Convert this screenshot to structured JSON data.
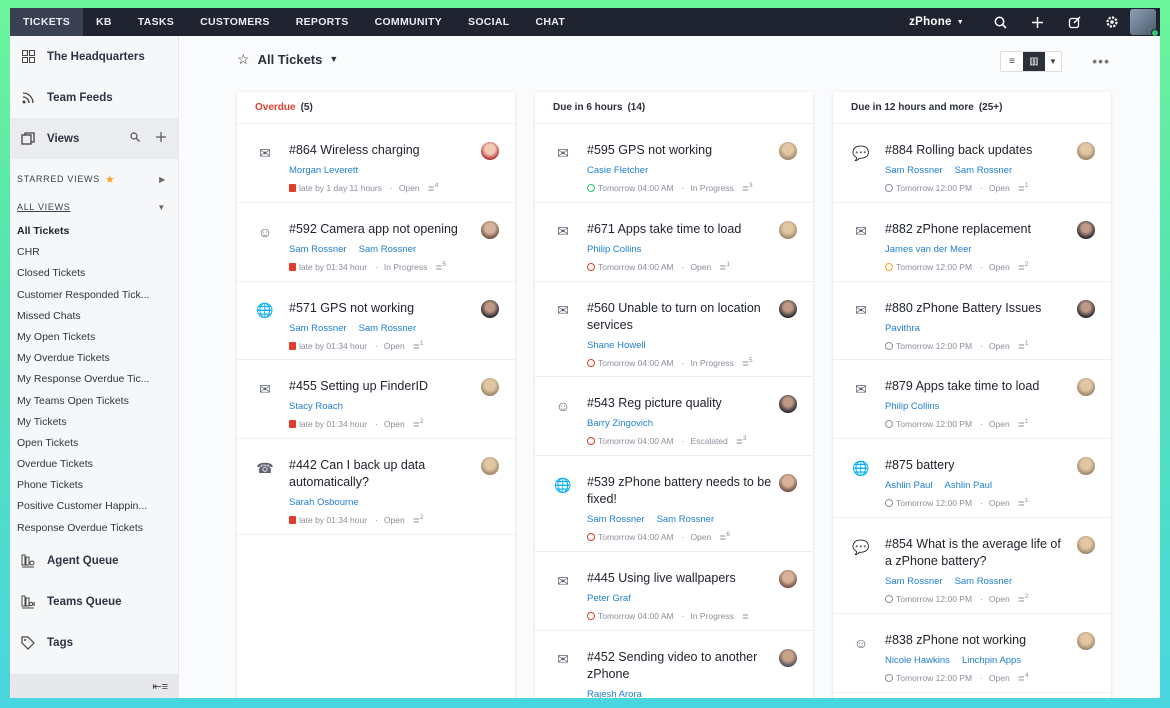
{
  "topnav": {
    "items": [
      {
        "label": "TICKETS",
        "active": true
      },
      {
        "label": "KB"
      },
      {
        "label": "TASKS"
      },
      {
        "label": "CUSTOMERS"
      },
      {
        "label": "REPORTS"
      },
      {
        "label": "COMMUNITY"
      },
      {
        "label": "SOCIAL"
      },
      {
        "label": "CHAT"
      }
    ],
    "brand": "zPhone",
    "icons": [
      "search-icon",
      "plus-icon",
      "compose-icon",
      "gear-icon"
    ]
  },
  "sidebar": {
    "top_items": [
      {
        "label": "The Headquarters",
        "icon": "grid-icon"
      },
      {
        "label": "Team Feeds",
        "icon": "rss-icon"
      }
    ],
    "views_label": "Views",
    "starred_label": "STARRED VIEWS",
    "all_views_label": "ALL VIEWS",
    "views": [
      "All Tickets",
      "CHR",
      "Closed Tickets",
      "Customer Responded Tick...",
      "Missed Chats",
      "My Open Tickets",
      "My Overdue Tickets",
      "My Response Overdue Tic...",
      "My Teams Open Tickets",
      "My Tickets",
      "Open Tickets",
      "Overdue Tickets",
      "Phone Tickets",
      "Positive Customer Happin...",
      "Response Overdue Tickets"
    ],
    "bottom_items": [
      {
        "label": "Agent Queue",
        "icon": "agent-queue-icon"
      },
      {
        "label": "Teams Queue",
        "icon": "teams-queue-icon"
      },
      {
        "label": "Tags",
        "icon": "tags-icon"
      }
    ]
  },
  "header": {
    "title": "All Tickets"
  },
  "colors": {
    "overdue": "#e23c2b",
    "link": "#1f7fd1",
    "nav_bg": "#1f2430"
  },
  "columns": [
    {
      "label": "Overdue",
      "count": "(5)",
      "red": true,
      "tickets": [
        {
          "subject": "#864 Wireless charging",
          "people": [
            "Morgan Leverett"
          ],
          "due": "late by 1 day 11 hours",
          "status": "Open",
          "threads": "4",
          "icon": "✉",
          "dueType": "red",
          "av": "a1"
        },
        {
          "subject": "#592 Camera app not opening",
          "people": [
            "Sam Rossner",
            "Sam Rossner"
          ],
          "due": "late by 01:34 hour",
          "status": "In Progress",
          "threads": "5",
          "icon": "☺",
          "dueType": "red",
          "av": "a2"
        },
        {
          "subject": "#571 GPS not working",
          "people": [
            "Sam Rossner",
            "Sam Rossner"
          ],
          "due": "late by 01:34 hour",
          "status": "Open",
          "threads": "1",
          "icon": "🌐",
          "dueType": "red",
          "av": "a3"
        },
        {
          "subject": "#455 Setting up FinderID",
          "people": [
            "Stacy Roach"
          ],
          "due": "late by 01:34 hour",
          "status": "Open",
          "threads": "2",
          "icon": "✉",
          "dueType": "red",
          "av": "a4"
        },
        {
          "subject": "#442 Can I back up data automatically?",
          "people": [
            "Sarah Osbourne"
          ],
          "due": "late by 01:34 hour",
          "status": "Open",
          "threads": "2",
          "icon": "☎",
          "dueType": "red",
          "av": "a4"
        }
      ]
    },
    {
      "label": "Due in 6 hours",
      "count": "(14)",
      "red": false,
      "tickets": [
        {
          "subject": "#595 GPS not working",
          "people": [
            "Casie Fletcher"
          ],
          "due": "Tomorrow 04:00 AM",
          "status": "In Progress",
          "threads": "3",
          "icon": "✉",
          "dueType": "green",
          "av": "a4"
        },
        {
          "subject": "#671 Apps take time to load",
          "people": [
            "Philip Collins"
          ],
          "due": "Tomorrow 04:00 AM",
          "status": "Open",
          "threads": "1",
          "icon": "✉",
          "dueType": "redc",
          "av": "a4"
        },
        {
          "subject": "#560 Unable to turn on location services",
          "people": [
            "Shane Howell"
          ],
          "due": "Tomorrow 04:00 AM",
          "status": "In Progress",
          "threads": "5",
          "icon": "✉",
          "dueType": "redc",
          "av": "a3"
        },
        {
          "subject": "#543 Reg picture quality",
          "people": [
            "Barry Zingovich"
          ],
          "due": "Tomorrow 04:00 AM",
          "status": "Escalated",
          "threads": "3",
          "icon": "☺",
          "dueType": "redc",
          "av": "a3"
        },
        {
          "subject": "#539 zPhone battery needs to be fixed!",
          "people": [
            "Sam Rossner",
            "Sam Rossner"
          ],
          "due": "Tomorrow 04:00 AM",
          "status": "Open",
          "threads": "6",
          "icon": "🌐",
          "dueType": "redc",
          "av": "a2"
        },
        {
          "subject": "#445 Using live wallpapers",
          "people": [
            "Peter Graf"
          ],
          "due": "Tomorrow 04:00 AM",
          "status": "In Progress",
          "threads": "",
          "icon": "✉",
          "dueType": "redc",
          "av": "a2"
        },
        {
          "subject": "#452 Sending video to another zPhone",
          "people": [
            "Rajesh Arora"
          ],
          "due": "",
          "status": "",
          "threads": "",
          "icon": "✉",
          "dueType": "redc",
          "av": "a5"
        }
      ]
    },
    {
      "label": "Due in 12 hours and more",
      "count": "(25+)",
      "red": false,
      "tickets": [
        {
          "subject": "#884 Rolling back updates",
          "people": [
            "Sam Rossner",
            "Sam Rossner"
          ],
          "due": "Tomorrow 12:00 PM",
          "status": "Open",
          "threads": "1",
          "icon": "💬",
          "dueType": "grey",
          "av": "a4"
        },
        {
          "subject": "#882 zPhone replacement",
          "people": [
            "James van der Meer"
          ],
          "due": "Tomorrow 12:00 PM",
          "status": "Open",
          "threads": "2",
          "icon": "✉",
          "dueType": "orange",
          "av": "a3"
        },
        {
          "subject": "#880 zPhone Battery Issues",
          "people": [
            "Pavithra"
          ],
          "due": "Tomorrow 12:00 PM",
          "status": "Open",
          "threads": "1",
          "icon": "✉",
          "dueType": "grey",
          "av": "a3"
        },
        {
          "subject": "#879 Apps take time to load",
          "people": [
            "Philip Collins"
          ],
          "due": "Tomorrow 12:00 PM",
          "status": "Open",
          "threads": "1",
          "icon": "✉",
          "dueType": "grey",
          "av": "a4"
        },
        {
          "subject": "#875 battery",
          "people": [
            "Ashlin Paul",
            "Ashlin Paul"
          ],
          "due": "Tomorrow 12:00 PM",
          "status": "Open",
          "threads": "1",
          "icon": "🌐",
          "dueType": "grey",
          "av": "a4"
        },
        {
          "subject": "#854 What is the average life of a zPhone battery?",
          "people": [
            "Sam Rossner",
            "Sam Rossner"
          ],
          "due": "Tomorrow 12:00 PM",
          "status": "Open",
          "threads": "2",
          "icon": "💬",
          "dueType": "grey",
          "av": "a4"
        },
        {
          "subject": "#838 zPhone not working",
          "people": [
            "Nicole Hawkins",
            "Linchpin Apps"
          ],
          "due": "Tomorrow 12:00 PM",
          "status": "Open",
          "threads": "4",
          "icon": "☺",
          "dueType": "grey",
          "av": "a4"
        }
      ]
    }
  ]
}
